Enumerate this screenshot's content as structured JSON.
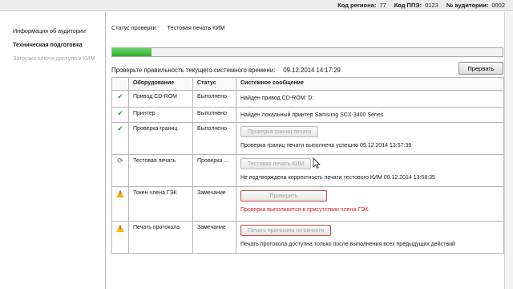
{
  "header": {
    "region_label": "Код региона:",
    "region_value": "77",
    "ppe_label": "Код ППЭ:",
    "ppe_value": "0123",
    "room_label": "№ аудитории:",
    "room_value": "0002"
  },
  "sidebar": {
    "items": [
      {
        "label": "Информация об аудитории"
      },
      {
        "label": "Техническая подготовка"
      },
      {
        "label": "Загрузка ключа доступа к КИМ"
      }
    ]
  },
  "status": {
    "label": "Статус проверки:",
    "value": "Тестовая печать КИМ",
    "progress_fraction": 0.1
  },
  "time": {
    "label": "Проверьте правильность текущего системного времени:",
    "value": "09.12.2014 14:17:29"
  },
  "interrupt_label": "Прервать",
  "table": {
    "headers": {
      "equipment": "Оборудование",
      "status": "Статус",
      "message": "Системное сообщение"
    },
    "rows": [
      {
        "icon": "check-icon",
        "equipment": "Привод CD-ROM",
        "status": "Выполнено",
        "message": "Найден привод CD-ROM: D:"
      },
      {
        "icon": "check-icon",
        "equipment": "Принтер",
        "status": "Выполнено",
        "message": "Найден локальный принтер Samsung SCX-3400 Series"
      },
      {
        "icon": "check-icon",
        "equipment": "Проверка границ",
        "status": "Выполнено",
        "button": "Проверка границ печати",
        "message": "Проверка границ печати выполнена успешно 09.12.2014 13:57:39"
      },
      {
        "icon": "refresh-icon",
        "equipment": "Тестовая печать",
        "status": "Проверка ...",
        "button": "Тестовая печать КИМ",
        "message": "Не подтверждена корректность печати тестового КИМ 09.12.2014 13:58:35"
      },
      {
        "icon": "warning-icon",
        "equipment": "Токен члена ГЭК",
        "status": "Замечание",
        "button": "Проверить",
        "message": "Проверка выполняется в присутствии члена ГЭК."
      },
      {
        "icon": "warning-icon",
        "equipment": "Печать протокола",
        "status": "Замечание",
        "button": "Печать протокола готовности",
        "message": "Печать протокола доступна только после выполнения всех предыдущих действий"
      }
    ]
  },
  "colors": {
    "progress_green": "#2fae2f",
    "warning_red": "#d32020",
    "check_green": "#35a135",
    "warning_yellow": "#f2b418"
  }
}
